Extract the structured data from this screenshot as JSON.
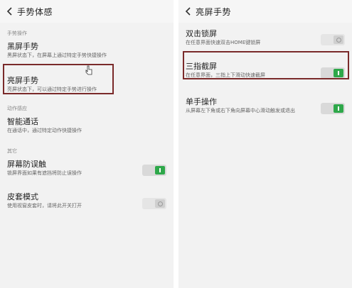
{
  "left": {
    "header_title": "手势体感",
    "sections": {
      "gesture_ops": "手势操作",
      "motion": "动作感应",
      "other": "其它"
    },
    "items": {
      "black_screen": {
        "title": "黑屏手势",
        "desc": "黑屏状态下，在屏幕上通过特定手势快捷操作"
      },
      "bright_screen": {
        "title": "亮屏手势",
        "desc": "亮屏状态下，可以通过特定手势进行操作"
      },
      "smart_call": {
        "title": "智能通话",
        "desc": "在通话中，通过特定动作快捷操作"
      },
      "anti_touch": {
        "title": "屏幕防误触",
        "desc": "锁屏界面如果有遮挡将防止误操作",
        "state": "on"
      },
      "cover_mode": {
        "title": "皮套模式",
        "desc": "使用视窗皮套时，请将此开关打开",
        "state": "off"
      }
    }
  },
  "right": {
    "header_title": "亮屏手势",
    "items": {
      "double_tap_lock": {
        "title": "双击锁屏",
        "desc": "在任意界面快速双击HOME键锁屏",
        "state": "off"
      },
      "three_finger_shot": {
        "title": "三指截屏",
        "desc": "在任意界面，三指上下滑动快速截屏",
        "state": "on"
      },
      "one_hand": {
        "title": "单手操作",
        "desc": "从屏幕左下角或右下角向屏幕中心滑动触发或退出",
        "state": "on"
      }
    }
  },
  "colors": {
    "toggle_on": "#2ea84a",
    "highlight_border": "#7a2a2a",
    "background": "#f2f2f2"
  }
}
